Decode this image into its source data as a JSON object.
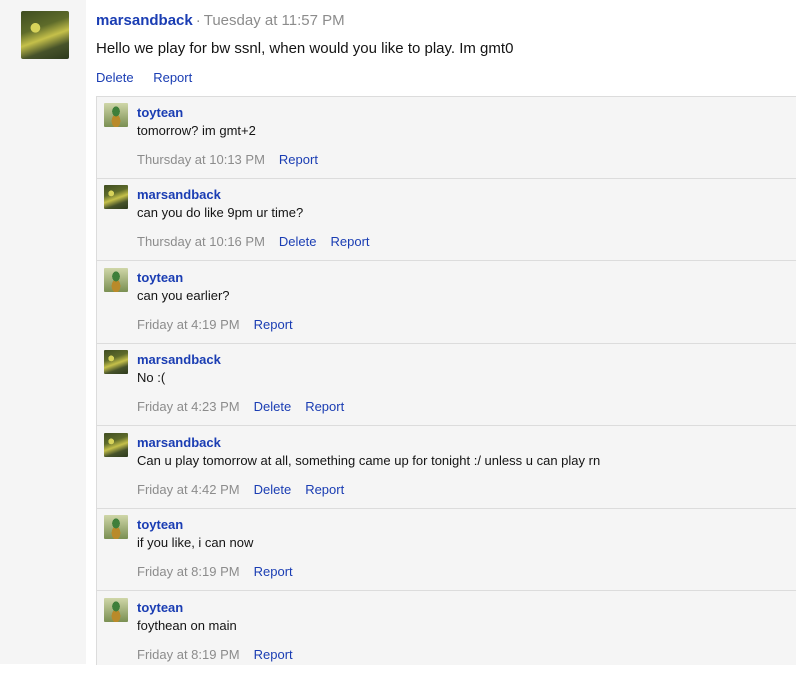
{
  "post": {
    "username": "marsandback",
    "separator": "·",
    "time": "Tuesday at 11:57 PM",
    "text": "Hello we play for bw ssnl, when would you like to play. Im gmt0",
    "actions": {
      "delete": "Delete",
      "report": "Report"
    }
  },
  "comments": [
    {
      "username": "toytean",
      "text": "tomorrow? im gmt+2",
      "time": "Thursday at 10:13 PM",
      "report": "Report"
    },
    {
      "username": "marsandback",
      "text": "can you do like 9pm ur time?",
      "time": "Thursday at 10:16 PM",
      "delete": "Delete",
      "report": "Report"
    },
    {
      "username": "toytean",
      "text": "can you earlier?",
      "time": "Friday at 4:19 PM",
      "report": "Report"
    },
    {
      "username": "marsandback",
      "text": "No :(",
      "time": "Friday at 4:23 PM",
      "delete": "Delete",
      "report": "Report"
    },
    {
      "username": "marsandback",
      "text": "Can u play tomorrow at all, something came up for tonight :/ unless u can play rn",
      "time": "Friday at 4:42 PM",
      "delete": "Delete",
      "report": "Report"
    },
    {
      "username": "toytean",
      "text": "if you like, i can now",
      "time": "Friday at 8:19 PM",
      "report": "Report"
    },
    {
      "username": "toytean",
      "text": "foythean on main",
      "time": "Friday at 8:19 PM",
      "report": "Report"
    }
  ]
}
